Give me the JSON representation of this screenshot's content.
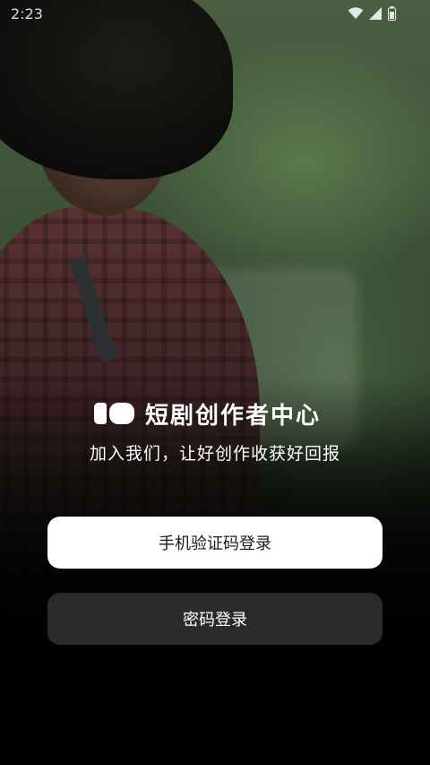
{
  "status_bar": {
    "time": "2:23",
    "icons": [
      "wifi-icon",
      "signal-icon",
      "battery-icon"
    ]
  },
  "brand": {
    "logo": "app-logo",
    "title": "短剧创作者中心"
  },
  "tagline": "加入我们，让好创作收获好回报",
  "actions": {
    "phone_login_label": "手机验证码登录",
    "password_login_label": "密码登录"
  },
  "colors": {
    "primary_button_bg": "#ffffff",
    "primary_button_text": "#1a1a1a",
    "secondary_button_bg": "#2b2b2b",
    "secondary_button_text": "#ffffff"
  }
}
